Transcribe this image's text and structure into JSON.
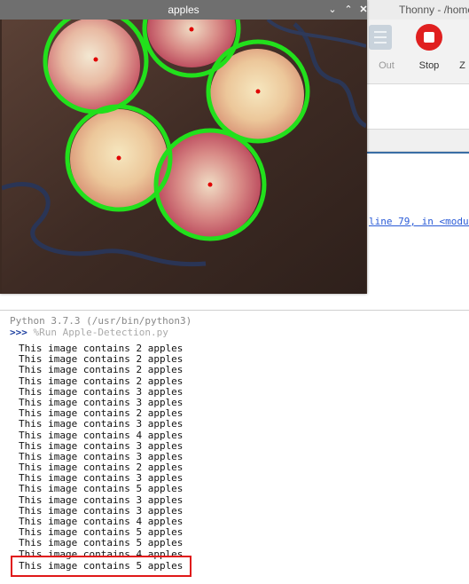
{
  "thonny": {
    "title": "Thonny - /home/",
    "toolbar": {
      "out_label": "Out",
      "stop_label": "Stop",
      "next_label": "Z"
    },
    "traceback_link": "line 79, in <modul"
  },
  "cv_window": {
    "title": "apples",
    "minimize_glyph": "⌄",
    "maximize_glyph": "⌃",
    "close_glyph": "✕",
    "detected_apple_count": 5,
    "circle_color": "#22e01c",
    "center_color": "#e00000"
  },
  "shell": {
    "header": "Python 3.7.3 (/usr/bin/python3)",
    "prompt": ">>>",
    "command": "%Run Apple-Detection.py",
    "lines": [
      "This image contains 2 apples",
      "This image contains 2 apples",
      "This image contains 2 apples",
      "This image contains 2 apples",
      "This image contains 3 apples",
      "This image contains 3 apples",
      "This image contains 2 apples",
      "This image contains 3 apples",
      "This image contains 4 apples",
      "This image contains 3 apples",
      "This image contains 3 apples",
      "This image contains 2 apples",
      "This image contains 3 apples",
      "This image contains 5 apples",
      "This image contains 3 apples",
      "This image contains 3 apples",
      "This image contains 4 apples",
      "This image contains 5 apples",
      "This image contains 5 apples",
      "This image contains 4 apples"
    ],
    "highlighted_line": "This image contains 5 apples",
    "highlight_color": "#e01818"
  }
}
